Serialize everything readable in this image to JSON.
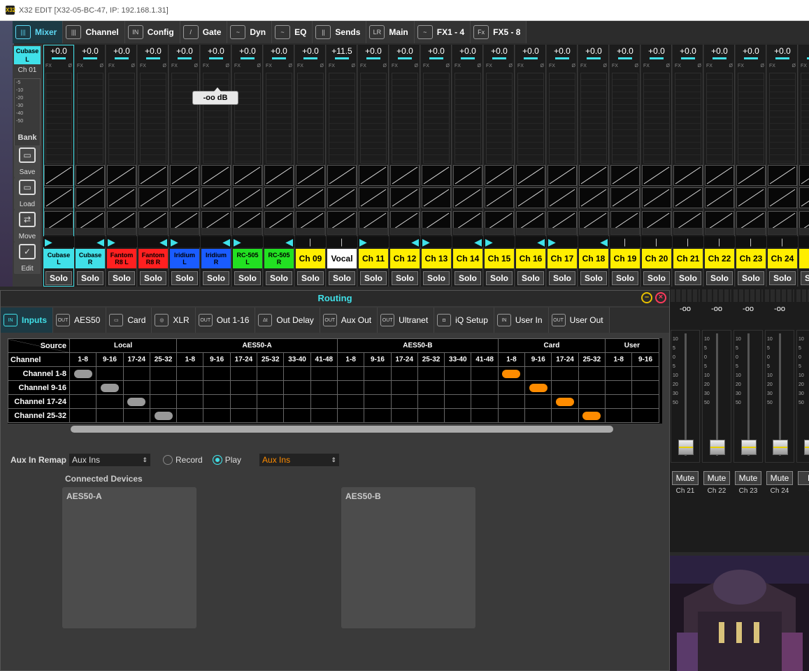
{
  "window": {
    "title": "X32 EDIT [X32-05-BC-47, IP: 192.168.1.31]",
    "logo_text": "X32"
  },
  "top_tabs": [
    {
      "label": "Mixer",
      "icon": "mixer-icon",
      "glyph": "|||"
    },
    {
      "label": "Channel",
      "icon": "channel-icon",
      "glyph": "|||"
    },
    {
      "label": "Config",
      "icon": "config-icon",
      "glyph": "IN"
    },
    {
      "label": "Gate",
      "icon": "gate-icon",
      "glyph": "/"
    },
    {
      "label": "Dyn",
      "icon": "dyn-icon",
      "glyph": "~"
    },
    {
      "label": "EQ",
      "icon": "eq-icon",
      "glyph": "~"
    },
    {
      "label": "Sends",
      "icon": "sends-icon",
      "glyph": "||"
    },
    {
      "label": "Main",
      "icon": "main-icon",
      "glyph": "LR"
    },
    {
      "label": "FX1 - 4",
      "icon": "fx-wave-icon",
      "glyph": "~"
    },
    {
      "label": "FX5 - 8",
      "icon": "fx-icon",
      "glyph": "Fx"
    }
  ],
  "left_panel": {
    "selected_channel": "Cubase\nL",
    "channel_id": "Ch 01",
    "meter_scale": [
      "-5",
      "-10",
      "-20",
      "-30",
      "-40",
      "-50"
    ],
    "bank_label": "Bank",
    "buttons": [
      {
        "label": "Save",
        "icon": "save-icon",
        "glyph": "▭"
      },
      {
        "label": "Load",
        "icon": "folder-icon",
        "glyph": "▭"
      },
      {
        "label": "Move",
        "icon": "move-arrows-icon",
        "glyph": "⇄"
      },
      {
        "label": "Edit",
        "icon": "checkmark-icon",
        "glyph": "✓"
      }
    ]
  },
  "fx_labels": {
    "fx": "FX",
    "phase": "Ø"
  },
  "colors": {
    "cyan": "#40e0e8",
    "red": "#ff2020",
    "blue": "#1a5cff",
    "green": "#22e022",
    "yellow": "#ffee00",
    "white": "#ffffff",
    "orange": "#ff8c00"
  },
  "channels": [
    {
      "name": "Cubase\nL",
      "gain": "+0.0",
      "color": "#40e0e8",
      "pan": "left"
    },
    {
      "name": "Cubase\nR",
      "gain": "+0.0",
      "color": "#40e0e8",
      "pan": "right"
    },
    {
      "name": "Fantom\nR8 L",
      "gain": "+0.0",
      "color": "#ff2020",
      "pan": "left"
    },
    {
      "name": "Fantom\nR8 R",
      "gain": "+0.0",
      "color": "#ff2020",
      "pan": "right"
    },
    {
      "name": "Iridium\nL",
      "gain": "+0.0",
      "color": "#1a5cff",
      "pan": "left"
    },
    {
      "name": "Iridium\nR",
      "gain": "+0.0",
      "color": "#1a5cff",
      "pan": "right"
    },
    {
      "name": "RC-505\nL",
      "gain": "+0.0",
      "color": "#22e022",
      "pan": "left"
    },
    {
      "name": "RC-505\nR",
      "gain": "+0.0",
      "color": "#22e022",
      "pan": "right"
    },
    {
      "name": "Ch 09",
      "gain": "+0.0",
      "color": "#ffee00",
      "pan": "center"
    },
    {
      "name": "Vocal",
      "gain": "+11.5",
      "color": "#ffffff",
      "pan": "center"
    },
    {
      "name": "Ch 11",
      "gain": "+0.0",
      "color": "#ffee00",
      "pan": "left"
    },
    {
      "name": "Ch 12",
      "gain": "+0.0",
      "color": "#ffee00",
      "pan": "right"
    },
    {
      "name": "Ch 13",
      "gain": "+0.0",
      "color": "#ffee00",
      "pan": "left"
    },
    {
      "name": "Ch 14",
      "gain": "+0.0",
      "color": "#ffee00",
      "pan": "right"
    },
    {
      "name": "Ch 15",
      "gain": "+0.0",
      "color": "#ffee00",
      "pan": "left"
    },
    {
      "name": "Ch 16",
      "gain": "+0.0",
      "color": "#ffee00",
      "pan": "right"
    },
    {
      "name": "Ch 17",
      "gain": "+0.0",
      "color": "#ffee00",
      "pan": "left"
    },
    {
      "name": "Ch 18",
      "gain": "+0.0",
      "color": "#ffee00",
      "pan": "right"
    },
    {
      "name": "Ch 19",
      "gain": "+0.0",
      "color": "#ffee00",
      "pan": "center"
    },
    {
      "name": "Ch 20",
      "gain": "+0.0",
      "color": "#ffee00",
      "pan": "center"
    },
    {
      "name": "Ch 21",
      "gain": "+0.0",
      "color": "#ffee00",
      "pan": "center"
    },
    {
      "name": "Ch 22",
      "gain": "+0.0",
      "color": "#ffee00",
      "pan": "center"
    },
    {
      "name": "Ch 23",
      "gain": "+0.0",
      "color": "#ffee00",
      "pan": "center"
    },
    {
      "name": "Ch 24",
      "gain": "+0.0",
      "color": "#ffee00",
      "pan": "center"
    },
    {
      "name": "C",
      "gain": "+",
      "color": "#ffee00",
      "pan": "center"
    }
  ],
  "solo_label": "Solo",
  "fader_tooltip": "-oo dB",
  "right_mixer": {
    "channels": [
      {
        "label": "Ch 21",
        "value": "-oo",
        "mute": "Mute"
      },
      {
        "label": "Ch 22",
        "value": "-oo",
        "mute": "Mute"
      },
      {
        "label": "Ch 23",
        "value": "-oo",
        "mute": "Mute"
      },
      {
        "label": "Ch 24",
        "value": "-oo",
        "mute": "Mute"
      },
      {
        "label": "C",
        "value": "-",
        "mute": "M"
      }
    ],
    "scale": [
      "10",
      "5",
      "0",
      "5",
      "10",
      "20",
      "30",
      "50"
    ]
  },
  "routing": {
    "title": "Routing",
    "tabs": [
      {
        "label": "Inputs",
        "icon": "inputs-icon",
        "glyph": "IN"
      },
      {
        "label": "AES50",
        "icon": "aes50-icon",
        "glyph": "OUT"
      },
      {
        "label": "Card",
        "icon": "card-icon",
        "glyph": "▭"
      },
      {
        "label": "XLR",
        "icon": "xlr-icon",
        "glyph": "◎"
      },
      {
        "label": "Out 1-16",
        "icon": "out-icon",
        "glyph": "OUT"
      },
      {
        "label": "Out Delay",
        "icon": "delay-icon",
        "glyph": "Δt"
      },
      {
        "label": "Aux Out",
        "icon": "aux-out-icon",
        "glyph": "OUT"
      },
      {
        "label": "Ultranet",
        "icon": "ultranet-icon",
        "glyph": "OUT"
      },
      {
        "label": "iQ Setup",
        "icon": "speaker-icon",
        "glyph": "◘"
      },
      {
        "label": "User In",
        "icon": "user-in-icon",
        "glyph": "IN"
      },
      {
        "label": "User Out",
        "icon": "user-out-icon",
        "glyph": "OUT"
      }
    ],
    "matrix": {
      "source_label": "Source",
      "channel_label": "Channel",
      "groups": [
        {
          "name": "Local",
          "cols": [
            "1-8",
            "9-16",
            "17-24",
            "25-32"
          ]
        },
        {
          "name": "AES50-A",
          "cols": [
            "1-8",
            "9-16",
            "17-24",
            "25-32",
            "33-40",
            "41-48"
          ]
        },
        {
          "name": "AES50-B",
          "cols": [
            "1-8",
            "9-16",
            "17-24",
            "25-32",
            "33-40",
            "41-48"
          ]
        },
        {
          "name": "Card",
          "cols": [
            "1-8",
            "9-16",
            "17-24",
            "25-32"
          ]
        },
        {
          "name": "User",
          "cols": [
            "1-8",
            "9-16"
          ]
        }
      ],
      "rows": [
        "Channel 1-8",
        "Channel 9-16",
        "Channel 17-24",
        "Channel 25-32"
      ]
    },
    "aux_in_remap": {
      "label": "Aux In Remap",
      "left_select": "Aux Ins",
      "record_label": "Record",
      "play_label": "Play",
      "mode": "Play",
      "right_select": "Aux Ins"
    },
    "connected_devices": {
      "header": "Connected Devices",
      "devices": [
        "AES50-A",
        "AES50-B"
      ]
    }
  }
}
